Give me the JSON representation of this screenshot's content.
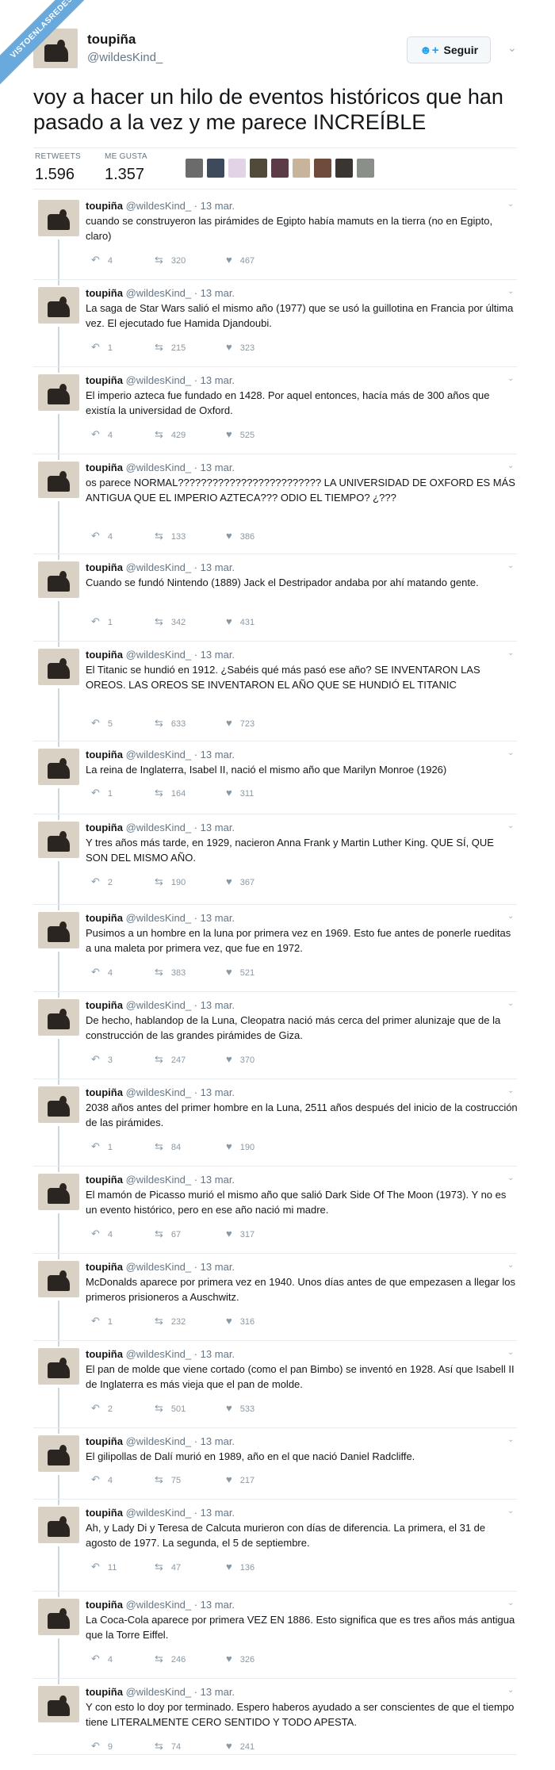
{
  "watermark": "VISTOENLASREDES",
  "header": {
    "name": "toupiña",
    "handle": "@wildesKind_",
    "follow_label": "Seguir",
    "chevron": "⌄",
    "text": "voy a hacer un hilo de eventos históricos que han pasado a la vez y me parece INCREÍBLE"
  },
  "stats": {
    "retweets_label": "RETWEETS",
    "retweets_value": "1.596",
    "likes_label": "ME GUSTA",
    "likes_value": "1.357"
  },
  "colors": {
    "accent": "#1da1f2",
    "faces": [
      "#6b6b6b",
      "#3d4a5c",
      "#e3d3e6",
      "#4f4a3a",
      "#5a3b46",
      "#c8b49a",
      "#6e4b3a",
      "#3a3530",
      "#8b8f8a"
    ]
  },
  "tweets": [
    {
      "name": "toupiña",
      "meta": "@wildesKind_ · 13 mar.",
      "text": "cuando se construyeron las pirámides de Egipto había mamuts en la tierra (no en Egipto, claro)",
      "replies": "4",
      "retweets": "320",
      "likes": "467"
    },
    {
      "name": "toupiña",
      "meta": "@wildesKind_ · 13 mar.",
      "text": "La saga de Star Wars salió el mismo año (1977) que se usó la guillotina en Francia por última vez. El ejecutado fue Hamida Djandoubi.",
      "replies": "1",
      "retweets": "215",
      "likes": "323"
    },
    {
      "name": "toupiña",
      "meta": "@wildesKind_ · 13 mar.",
      "text": "El imperio azteca fue fundado en 1428. Por aquel entonces, hacía más de 300 años que existía la universidad de Oxford.",
      "replies": "4",
      "retweets": "429",
      "likes": "525"
    },
    {
      "name": "toupiña",
      "meta": "@wildesKind_ · 13 mar.",
      "text": "os parece NORMAL????????????????????????? LA UNIVERSIDAD DE OXFORD ES MÁS ANTIGUA QUE EL IMPERIO AZTECA??? ODIO EL TIEMPO? ¿???",
      "replies": "4",
      "retweets": "133",
      "likes": "386"
    },
    {
      "name": "toupiña",
      "meta": "@wildesKind_ · 13 mar.",
      "text": "Cuando se fundó Nintendo (1889) Jack el Destripador andaba por ahí matando gente.",
      "replies": "1",
      "retweets": "342",
      "likes": "431"
    },
    {
      "name": "toupiña",
      "meta": "@wildesKind_ · 13 mar.",
      "text": "El Titanic se hundió en 1912. ¿Sabéis qué más pasó ese año? SE INVENTARON LAS OREOS. LAS OREOS SE INVENTARON EL AÑO QUE SE HUNDIÓ EL TITANIC",
      "replies": "5",
      "retweets": "633",
      "likes": "723"
    },
    {
      "name": "toupiña",
      "meta": "@wildesKind_ · 13 mar.",
      "text": "La reina de Inglaterra, Isabel II, nació el mismo año que Marilyn Monroe (1926)",
      "replies": "1",
      "retweets": "164",
      "likes": "311"
    },
    {
      "name": "toupiña",
      "meta": "@wildesKind_ · 13 mar.",
      "text": "Y tres años más tarde, en 1929, nacieron Anna Frank y Martin Luther King. QUE SÍ, QUE SON DEL MISMO AÑO.",
      "replies": "2",
      "retweets": "190",
      "likes": "367"
    },
    {
      "name": "toupiña",
      "meta": "@wildesKind_ · 13 mar.",
      "text": "Pusimos a un hombre en la luna por primera vez en 1969. Esto fue antes de ponerle rueditas a una maleta por primera vez, que fue en 1972.",
      "replies": "4",
      "retweets": "383",
      "likes": "521"
    },
    {
      "name": "toupiña",
      "meta": "@wildesKind_ · 13 mar.",
      "text": "De hecho, hablandop de la Luna, Cleopatra nació más cerca del primer alunizaje que de la construcción de las grandes pirámides de Giza.",
      "replies": "3",
      "retweets": "247",
      "likes": "370"
    },
    {
      "name": "toupiña",
      "meta": "@wildesKind_ · 13 mar.",
      "text": "2038 años antes del primer hombre en la Luna, 2511 años después del inicio de la costrucción de las pirámides.",
      "replies": "1",
      "retweets": "84",
      "likes": "190"
    },
    {
      "name": "toupiña",
      "meta": "@wildesKind_ · 13 mar.",
      "text": "El mamón de Picasso murió el mismo año que salió Dark Side Of The Moon (1973). Y no es un evento histórico, pero en ese año nació mi madre.",
      "replies": "4",
      "retweets": "67",
      "likes": "317"
    },
    {
      "name": "toupiña",
      "meta": "@wildesKind_ · 13 mar.",
      "text": "McDonalds aparece por primera vez en 1940. Unos días antes de que empezasen a llegar los primeros prisioneros a Auschwitz.",
      "replies": "1",
      "retweets": "232",
      "likes": "316"
    },
    {
      "name": "toupiña",
      "meta": "@wildesKind_ · 13 mar.",
      "text": "El pan de molde que viene cortado (como el pan Bimbo) se inventó en 1928. Así que Isabell II de Inglaterra es más vieja que el pan de molde.",
      "replies": "2",
      "retweets": "501",
      "likes": "533"
    },
    {
      "name": "toupiña",
      "meta": "@wildesKind_ · 13 mar.",
      "text": "El gilipollas de Dalí murió en 1989, año en el que nació Daniel Radcliffe.",
      "replies": "4",
      "retweets": "75",
      "likes": "217"
    },
    {
      "name": "toupiña",
      "meta": "@wildesKind_ · 13 mar.",
      "text": "Ah, y Lady Di y Teresa de Calcuta murieron con días de diferencia. La primera, el 31 de agosto de 1977. La segunda, el 5 de septiembre.",
      "replies": "11",
      "retweets": "47",
      "likes": "136"
    },
    {
      "name": "toupiña",
      "meta": "@wildesKind_ · 13 mar.",
      "text": "La Coca-Cola aparece por primera VEZ EN 1886. Esto significa que es tres años más antigua que la Torre Eiffel.",
      "replies": "4",
      "retweets": "246",
      "likes": "326"
    },
    {
      "name": "toupiña",
      "meta": "@wildesKind_ · 13 mar.",
      "text": "Y con esto lo doy por terminado. Espero haberos ayudado a ser conscientes de que el tiempo tiene LITERALMENTE CERO SENTIDO Y TODO APESTA.",
      "replies": "9",
      "retweets": "74",
      "likes": "241"
    }
  ]
}
